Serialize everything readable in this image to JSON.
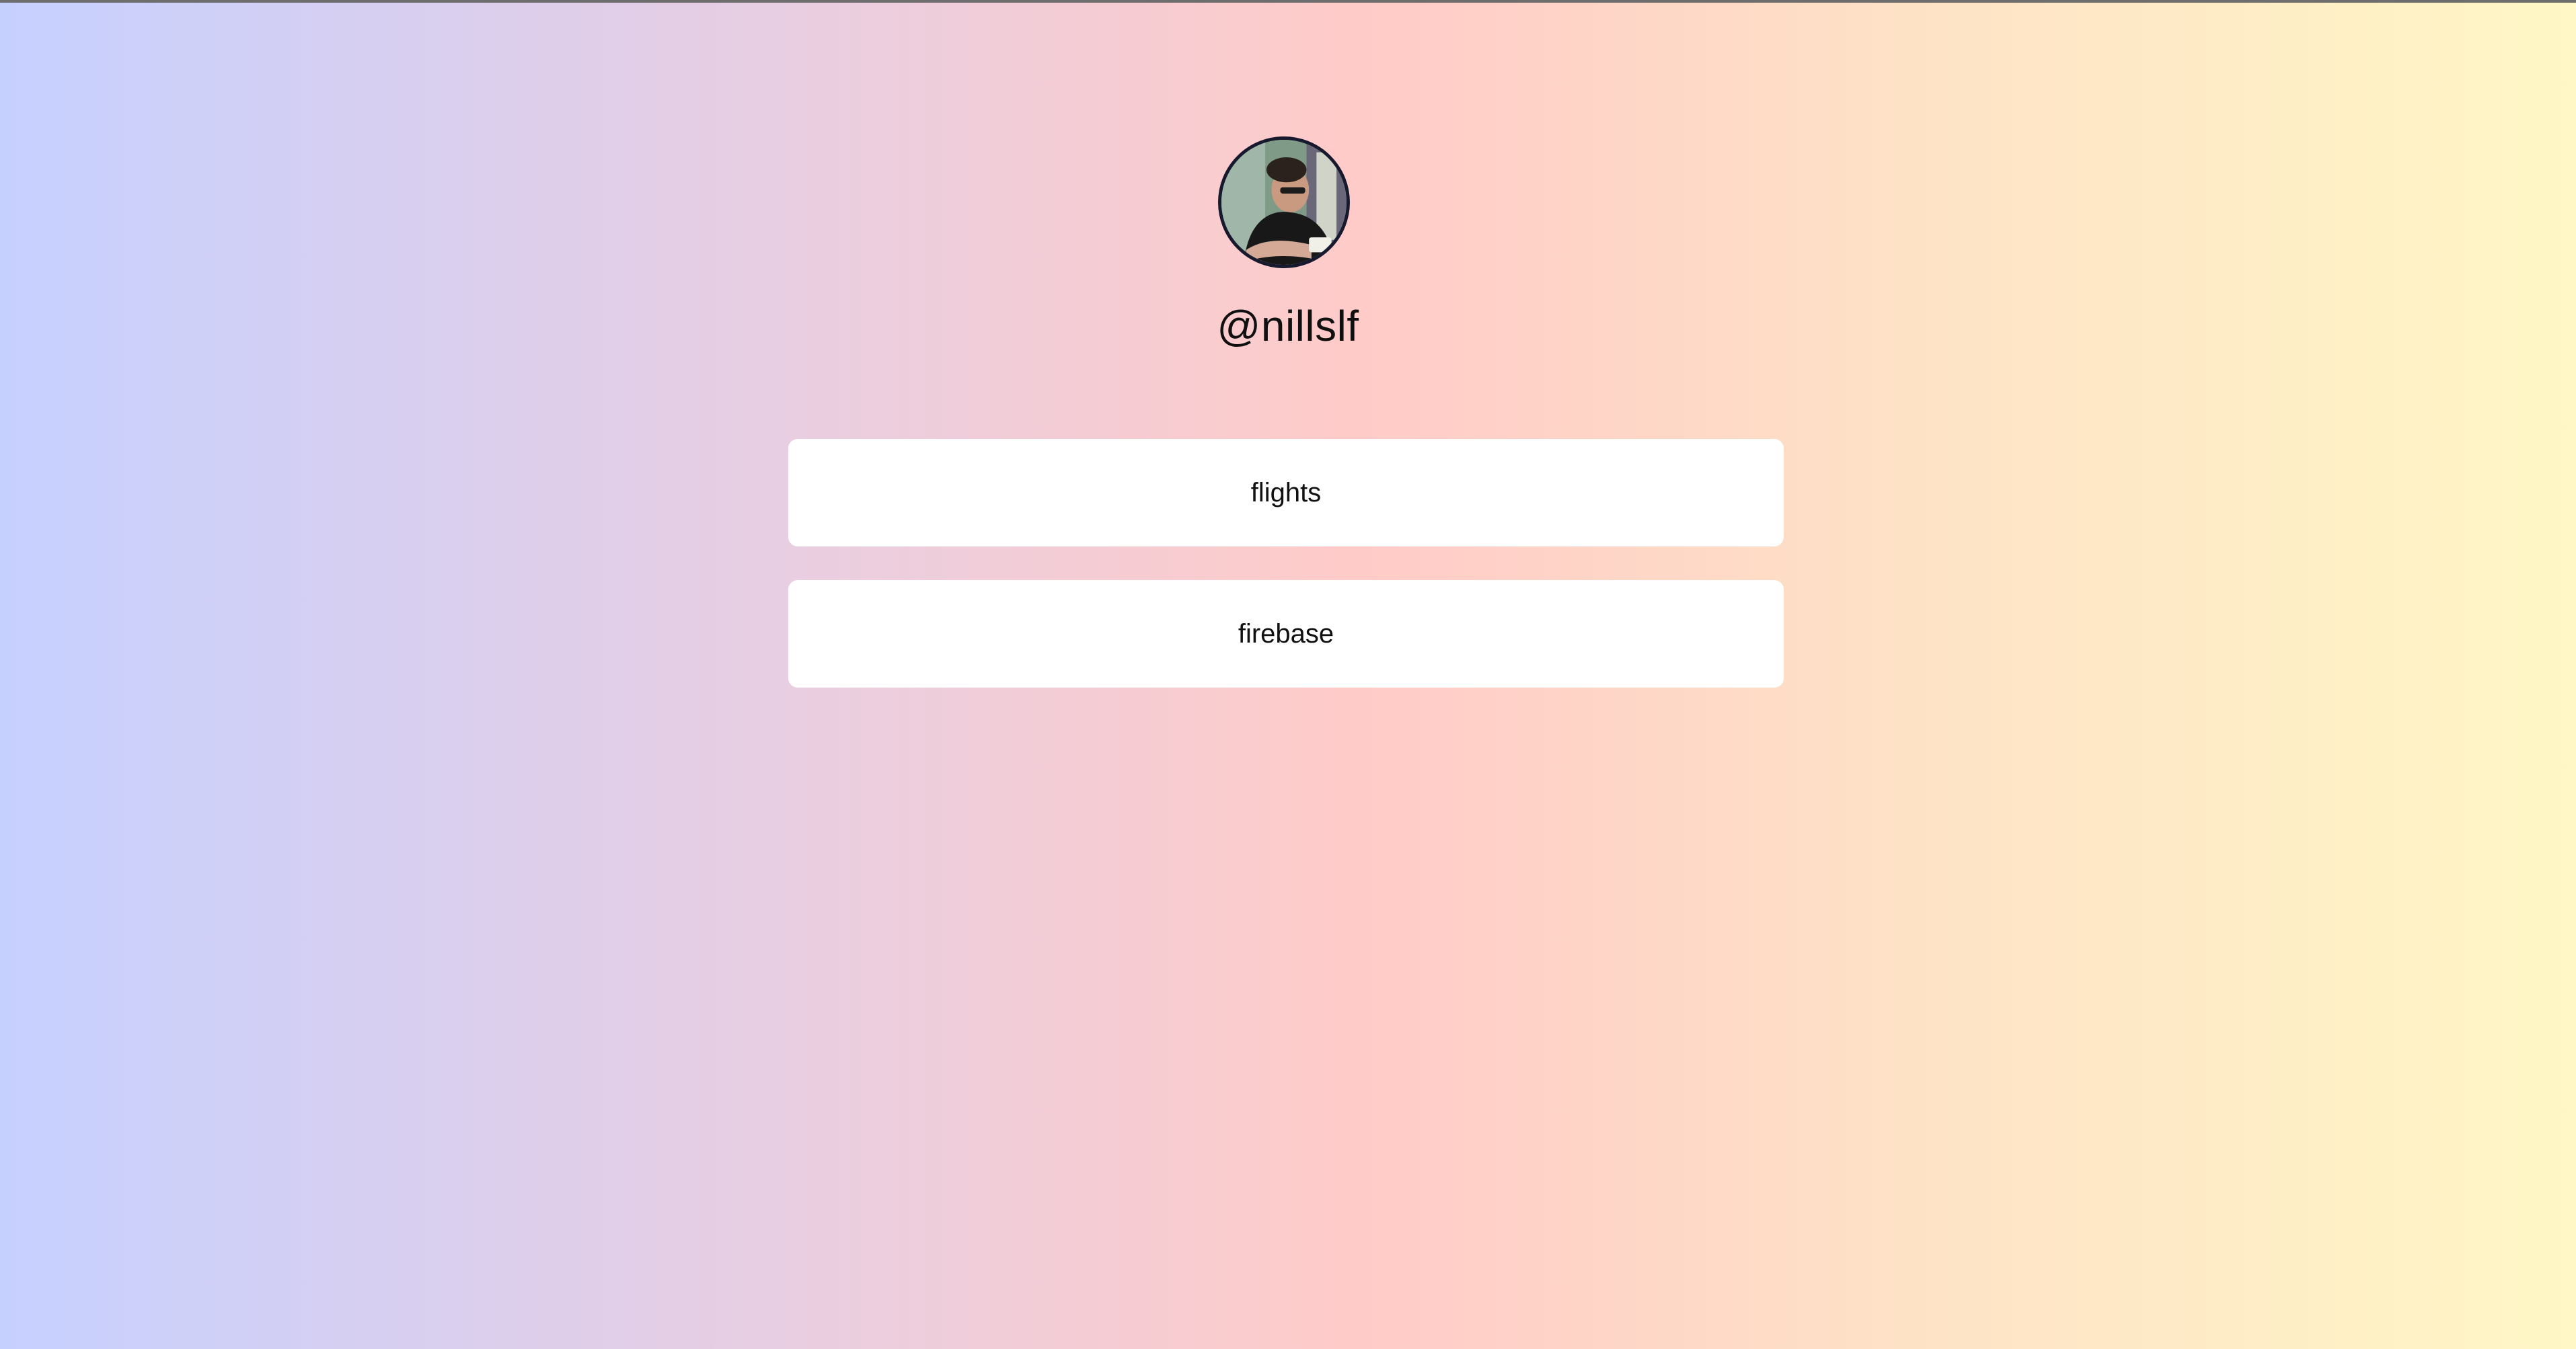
{
  "profile": {
    "username": "@nillslf",
    "avatar_alt": "profile photo"
  },
  "links": [
    {
      "label": "flights"
    },
    {
      "label": "firebase"
    }
  ],
  "colors": {
    "gradient_start": "#c6d0ff",
    "gradient_mid": "#ffcbc8",
    "gradient_end": "#fff7c6",
    "card_background": "#ffffff",
    "avatar_border": "#171a2e",
    "text": "#101010"
  }
}
